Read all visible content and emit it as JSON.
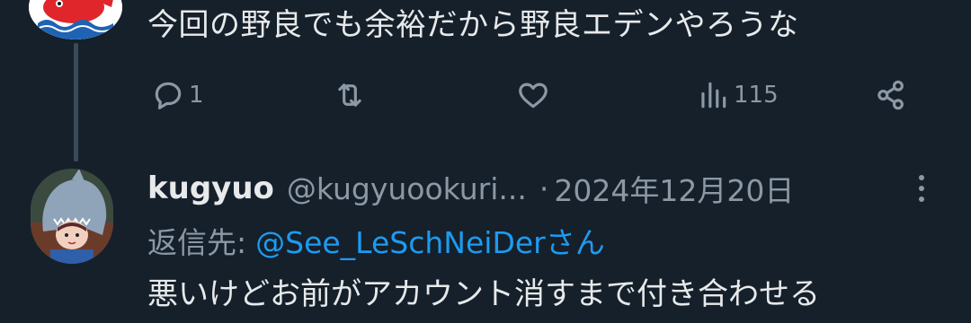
{
  "parent_tweet": {
    "text": "今回の野良でも余裕だから野良エデンやろうな",
    "actions": {
      "reply": {
        "icon": "reply-icon",
        "count": "1"
      },
      "retweet": {
        "icon": "retweet-icon",
        "count": ""
      },
      "like": {
        "icon": "heart-icon",
        "count": ""
      },
      "views": {
        "icon": "analytics-icon",
        "count": "115"
      },
      "share": {
        "icon": "share-icon",
        "count": ""
      }
    }
  },
  "reply_tweet": {
    "display_name": "kugyuo",
    "handle": "@kugyuookuri...",
    "separator": "·",
    "date": "2024年12月20日",
    "reply_label": "返信先:",
    "reply_mention": "@See_LeSchNeiDerさん",
    "text": "悪いけどお前がアカウント消すまで付き合わせる"
  },
  "colors": {
    "background": "#15202b",
    "text_primary": "#e7e9ea",
    "text_secondary": "#8b98a5",
    "accent": "#1d9bf0",
    "thread_line": "#3c4a57"
  }
}
